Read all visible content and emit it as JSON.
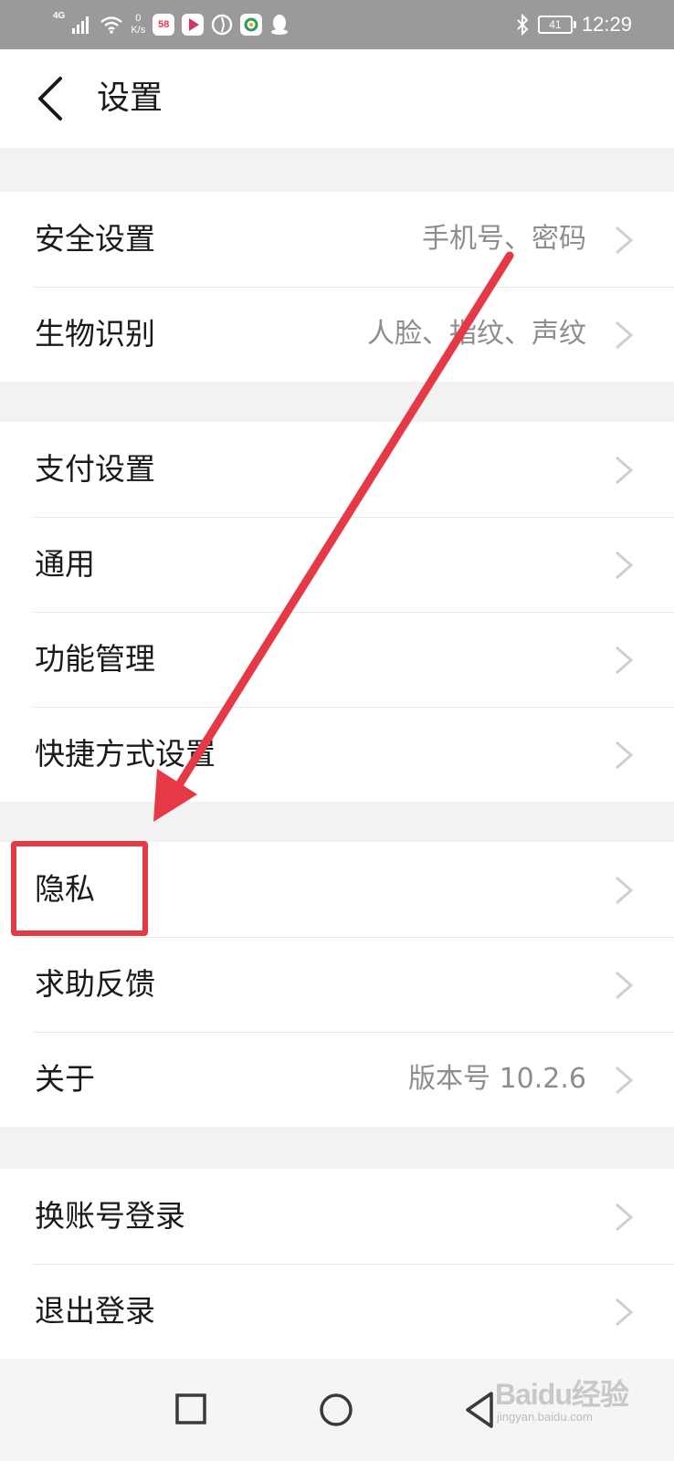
{
  "status_bar": {
    "network": "4G",
    "speed_value": "0",
    "speed_unit": "K/s",
    "apps": [
      "58"
    ],
    "battery": "41",
    "time": "12:29",
    "icons": [
      "signal-icon",
      "wifi-icon",
      "app-58-icon",
      "video-app-icon",
      "browser-app-icon",
      "camera-app-icon",
      "qq-icon",
      "bluetooth-icon",
      "battery-icon"
    ]
  },
  "header": {
    "title": "设置",
    "back_icon": "chevron-left-icon"
  },
  "groups": [
    {
      "rows": [
        {
          "label": "安全设置",
          "value": "手机号、密码"
        },
        {
          "label": "生物识别",
          "value": "人脸、指纹、声纹"
        }
      ]
    },
    {
      "rows": [
        {
          "label": "支付设置",
          "value": ""
        },
        {
          "label": "通用",
          "value": ""
        },
        {
          "label": "功能管理",
          "value": ""
        },
        {
          "label": "快捷方式设置",
          "value": ""
        }
      ]
    },
    {
      "rows": [
        {
          "label": "隐私",
          "value": ""
        },
        {
          "label": "求助反馈",
          "value": ""
        },
        {
          "label": "关于",
          "value": "版本号 10.2.6"
        }
      ]
    },
    {
      "rows": [
        {
          "label": "换账号登录",
          "value": ""
        },
        {
          "label": "退出登录",
          "value": ""
        }
      ]
    }
  ],
  "annotation": {
    "color": "#e63946",
    "highlighted_row": "隐私"
  },
  "nav_bar": {
    "buttons": [
      "recents-square-icon",
      "home-circle-icon",
      "back-triangle-icon"
    ]
  },
  "watermark": {
    "main": "Baidu经验",
    "sub": "jingyan.baidu.com"
  },
  "colors": {
    "status_bar": "#9a9a9a",
    "background": "#f2f2f2",
    "card": "#ffffff",
    "secondary_text": "#8d8d8d",
    "accent_red": "#e63946"
  }
}
